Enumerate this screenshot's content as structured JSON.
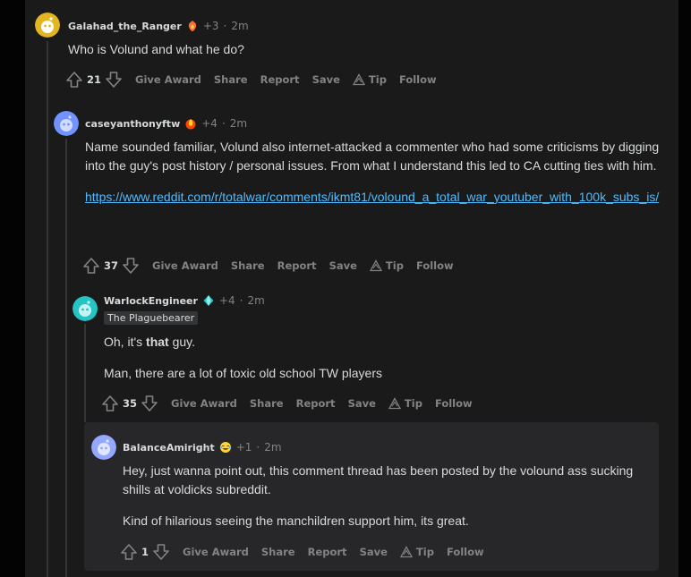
{
  "colors": {
    "background": "#1a1a1b",
    "text": "#d7dadc",
    "muted": "#818384",
    "link": "#4fbcff",
    "thread_line": "#343536",
    "highlight_box": "#272729"
  },
  "actions_labels": {
    "give_award": "Give Award",
    "share": "Share",
    "report": "Report",
    "save": "Save",
    "tip": "Tip",
    "follow": "Follow"
  },
  "comments": [
    {
      "username": "Galahad_the_Ranger",
      "karma": "+3",
      "separator": "·",
      "time": "2m",
      "award_icon": "flame-shield-award-icon",
      "avatar_color": "#e3b521",
      "body": "Who is Volund and what he do?",
      "score": "21"
    },
    {
      "username": "caseyanthonyftw",
      "karma": "+4",
      "separator": "·",
      "time": "2m",
      "award_icon": "fire-award-icon",
      "avatar_color": "#7193ff",
      "body_lines": [
        "Name sounded familiar, Volund also internet-attacked a commenter who had some criticisms by digging into the guy's post history / personal issues. From what I understand this led to CA cutting ties with him."
      ],
      "link": "https://www.reddit.com/r/totalwar/comments/ikmt81/volound_a_total_war_youtuber_with_100k_subs_is/",
      "score": "37"
    },
    {
      "username": "WarlockEngineer",
      "karma": "+4",
      "separator": "·",
      "time": "2m",
      "award_icon": "gem-award-icon",
      "avatar_color": "#24c4c4",
      "flair": "The Plaguebearer",
      "body_prefix": "Oh, it's ",
      "body_bold": "that",
      "body_suffix": " guy.",
      "body_second": "Man, there are a lot of toxic old school TW players",
      "score": "35"
    },
    {
      "username": "BalanceAmiright",
      "karma": "+1",
      "separator": "·",
      "time": "2m",
      "award_icon": "crying-laughing-award-icon",
      "avatar_color": "#94a8ff",
      "body_first": "Hey, just wanna point out, this comment thread has been posted by the volound ass sucking shills at voldicks subreddit.",
      "body_second": "Kind of hilarious seeing the manchildren support him, its great.",
      "score": "1"
    }
  ]
}
